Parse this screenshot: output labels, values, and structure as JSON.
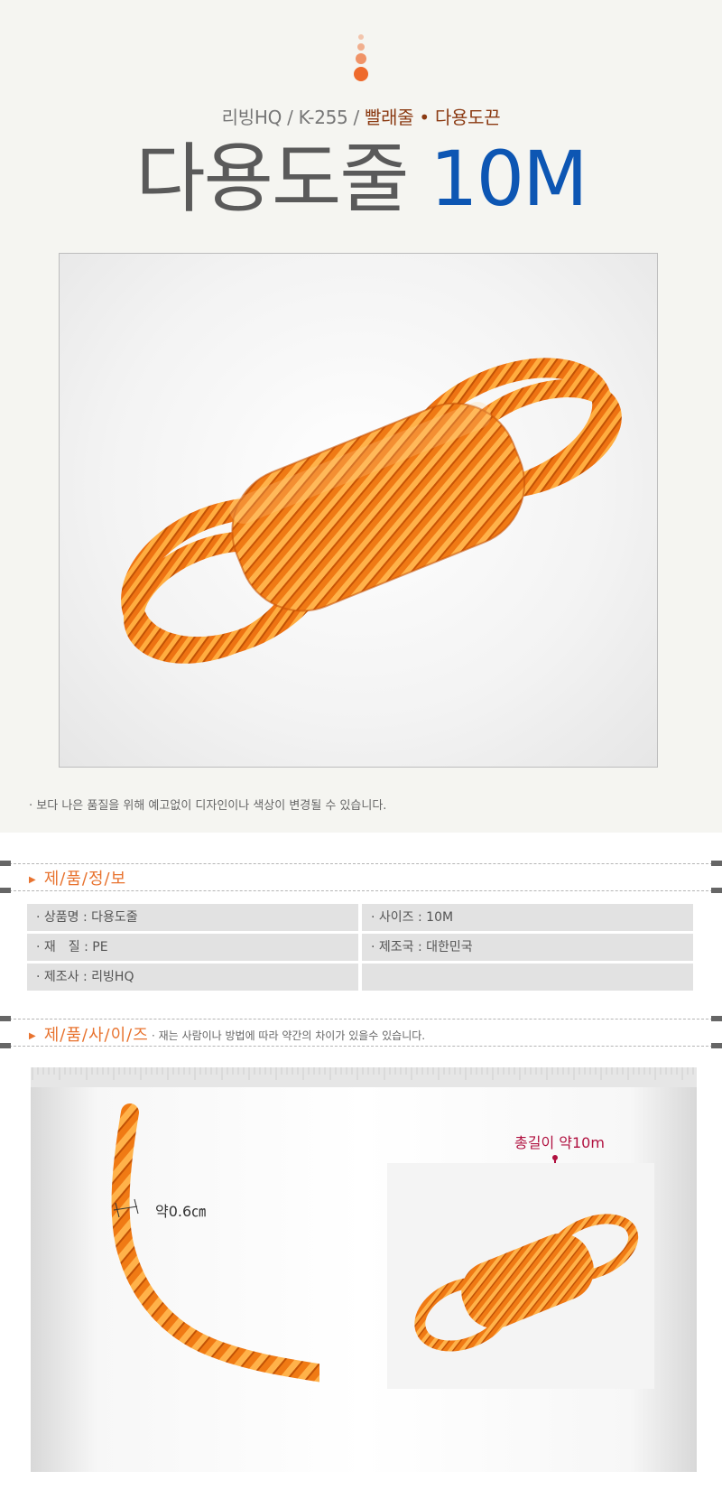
{
  "header": {
    "subtitle_main": "리빙HQ / K-255 / ",
    "subtitle_highlight": "빨래줄 • 다용도끈",
    "title_main": "다용도줄",
    "title_accent": "10M"
  },
  "notice": "· 보다 나은 품질을 위해 예고없이 디자인이나 색상이 변경될 수 있습니다.",
  "product_info": {
    "section_title": "제/품/정/보",
    "rows": [
      [
        "· 상품명 : 다용도줄",
        "· 사이즈 : 10M"
      ],
      [
        "· 재　질 : PE",
        "· 제조국 : 대한민국"
      ],
      [
        "· 제조사 : 리빙HQ",
        ""
      ]
    ]
  },
  "product_size": {
    "section_title": "제/품/사/이/즈",
    "note": "· 재는 사람이나 방법에 따라 약간의 차이가 있을수 있습니다.",
    "thickness_label": "약0.6㎝",
    "length_label": "총길이 약10m"
  },
  "colors": {
    "accent_orange": "#e8732f",
    "title_blue": "#0d56b3",
    "rope_orange": "#f07a14",
    "annotation_red": "#b0103f"
  }
}
